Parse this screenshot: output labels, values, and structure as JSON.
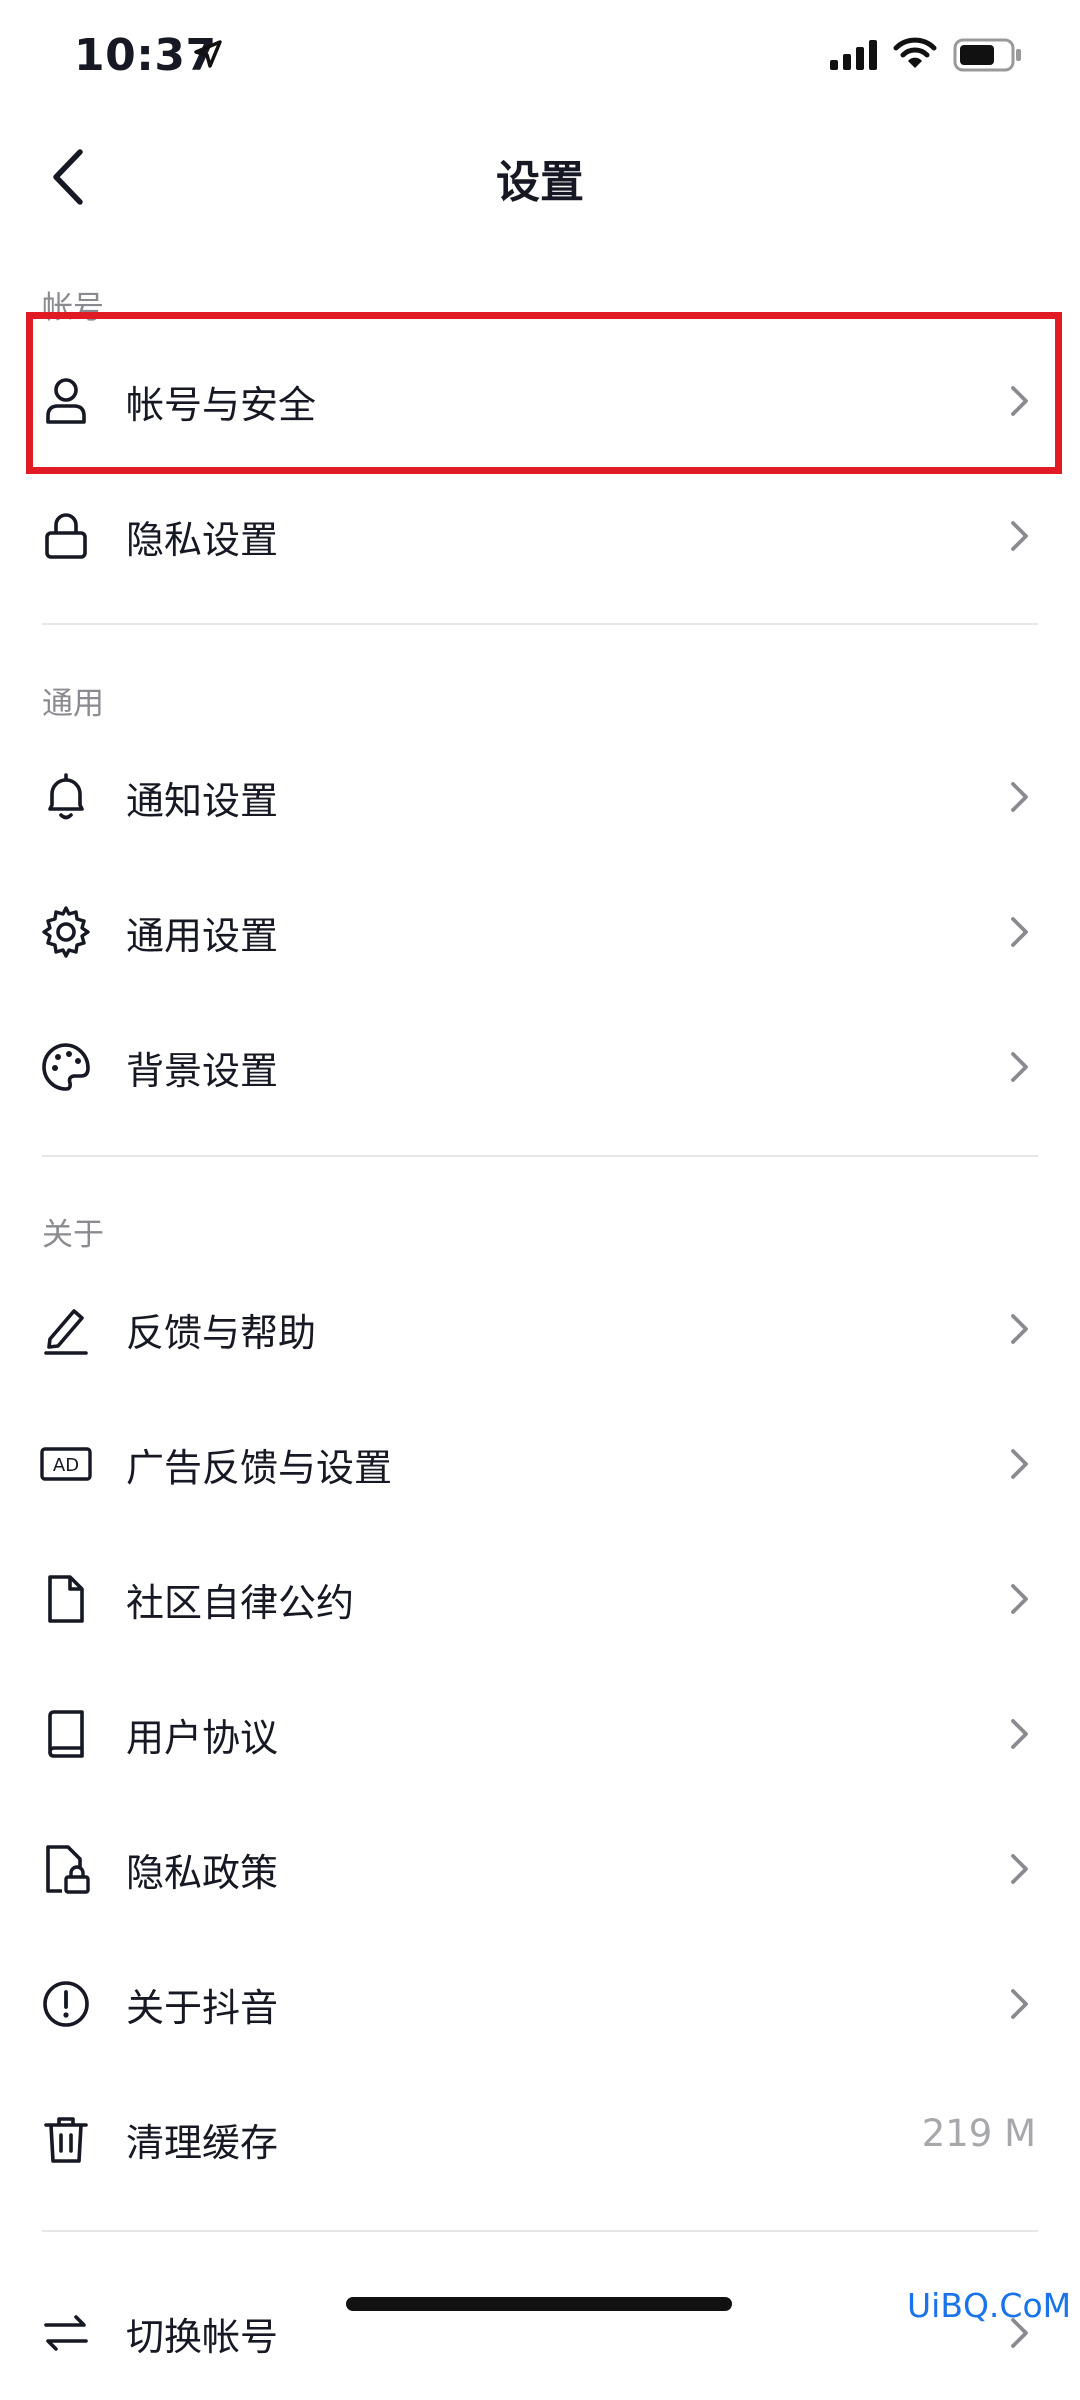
{
  "status_bar": {
    "time": "10:37"
  },
  "header": {
    "title": "设置"
  },
  "sections": [
    {
      "label": "帐号"
    },
    {
      "label": "通用"
    },
    {
      "label": "关于"
    }
  ],
  "rows": [
    {
      "label": "帐号与安全",
      "icon": "user-icon"
    },
    {
      "label": "隐私设置",
      "icon": "lock-icon"
    },
    {
      "label": "通知设置",
      "icon": "bell-icon"
    },
    {
      "label": "通用设置",
      "icon": "gear-icon"
    },
    {
      "label": "背景设置",
      "icon": "palette-icon"
    },
    {
      "label": "反馈与帮助",
      "icon": "edit-icon"
    },
    {
      "label": "广告反馈与设置",
      "icon": "ad-icon"
    },
    {
      "label": "社区自律公约",
      "icon": "document-icon"
    },
    {
      "label": "用户协议",
      "icon": "book-icon"
    },
    {
      "label": "隐私政策",
      "icon": "privacy-document-icon"
    },
    {
      "label": "关于抖音",
      "icon": "info-icon"
    },
    {
      "label": "清理缓存",
      "icon": "trash-icon",
      "value": "219 M"
    },
    {
      "label": "切换帐号",
      "icon": "switch-icon"
    }
  ],
  "ad_icon_text": "AD",
  "watermark": "UiBQ.CoM",
  "colors": {
    "highlight": "#e01b24",
    "text": "#161823",
    "muted": "#8a8b91"
  }
}
